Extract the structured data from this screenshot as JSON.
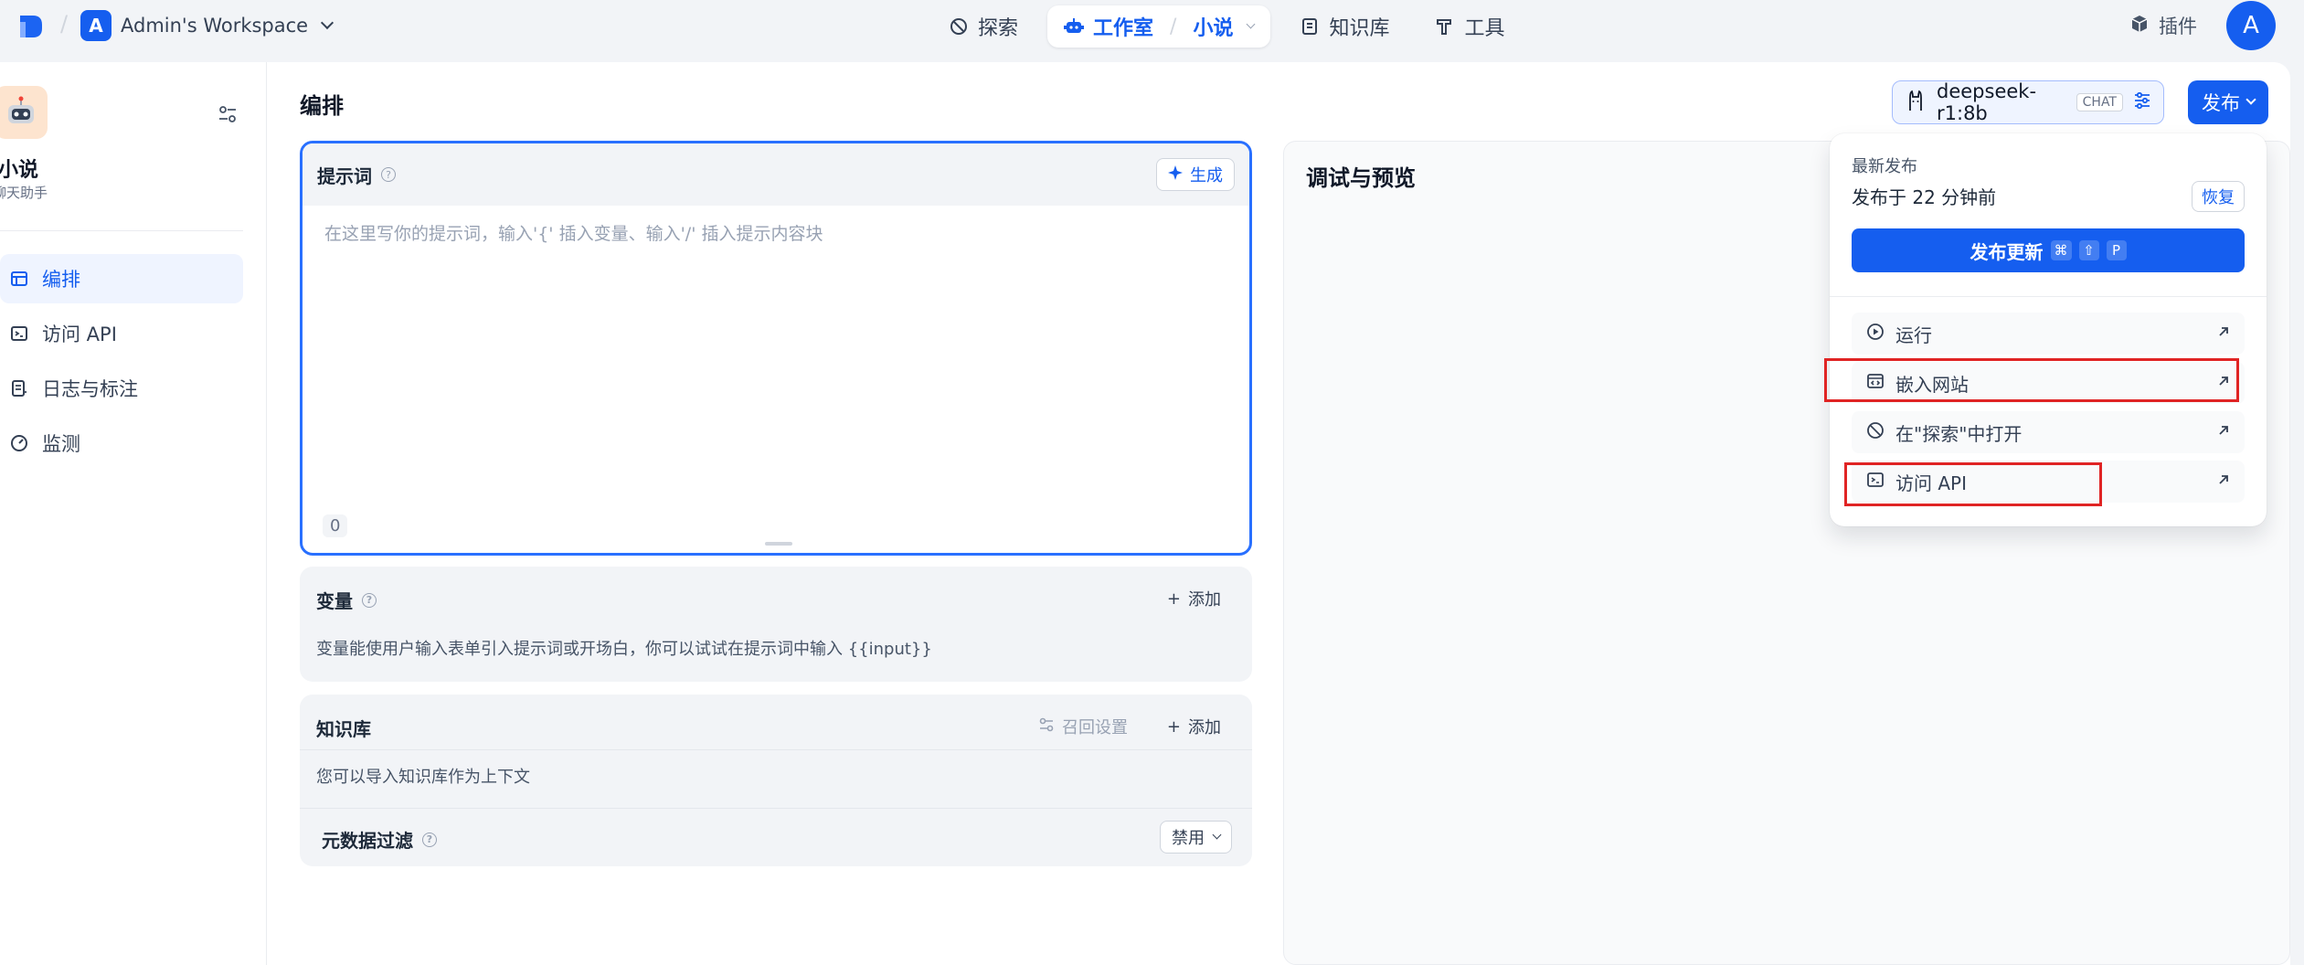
{
  "workspace": {
    "avatar_letter": "A",
    "name": "Admin's Workspace"
  },
  "nav": {
    "explore": "探索",
    "studio": "工作室",
    "current_app": "小说",
    "knowledge": "知识库",
    "tools": "工具"
  },
  "plugins_label": "插件",
  "user_avatar_letter": "A",
  "sidebar": {
    "app_name": "小说",
    "app_desc": "聊天助手",
    "items": [
      {
        "label": "编排",
        "icon": "layout-icon",
        "active": true
      },
      {
        "label": "访问 API",
        "icon": "terminal-icon",
        "active": false
      },
      {
        "label": "日志与标注",
        "icon": "log-icon",
        "active": false
      },
      {
        "label": "监测",
        "icon": "gauge-icon",
        "active": false
      }
    ]
  },
  "page_title": "编排",
  "prompt": {
    "title": "提示词",
    "generate_label": "生成",
    "placeholder": "在这里写你的提示词，输入'{' 插入变量、输入'/' 插入提示内容块",
    "char_count": "0"
  },
  "variables": {
    "title": "变量",
    "add_label": "添加",
    "description": "变量能使用户输入表单引入提示词或开场白，你可以试试在提示词中输入 {{input}}"
  },
  "knowledge": {
    "title": "知识库",
    "recall_label": "召回设置",
    "add_label": "添加",
    "description": "您可以导入知识库作为上下文",
    "metadata_filter_label": "元数据过滤",
    "metadata_filter_value": "禁用"
  },
  "preview": {
    "title": "调试与预览"
  },
  "model": {
    "name": "deepseek-r1:8b",
    "tag": "CHAT"
  },
  "publish_button": "发布",
  "publish_menu": {
    "latest_label": "最新发布",
    "published_time": "发布于 22 分钟前",
    "restore_label": "恢复",
    "update_label": "发布更新",
    "shortcut_keys": [
      "⌘",
      "⇧",
      "P"
    ],
    "items": [
      {
        "label": "运行",
        "icon": "play-circle-icon"
      },
      {
        "label": "嵌入网站",
        "icon": "embed-icon"
      },
      {
        "label": "在\"探索\"中打开",
        "icon": "compass-icon"
      },
      {
        "label": "访问 API",
        "icon": "terminal-icon"
      }
    ]
  },
  "colors": {
    "accent": "#155eef",
    "highlight": "#e02424"
  }
}
